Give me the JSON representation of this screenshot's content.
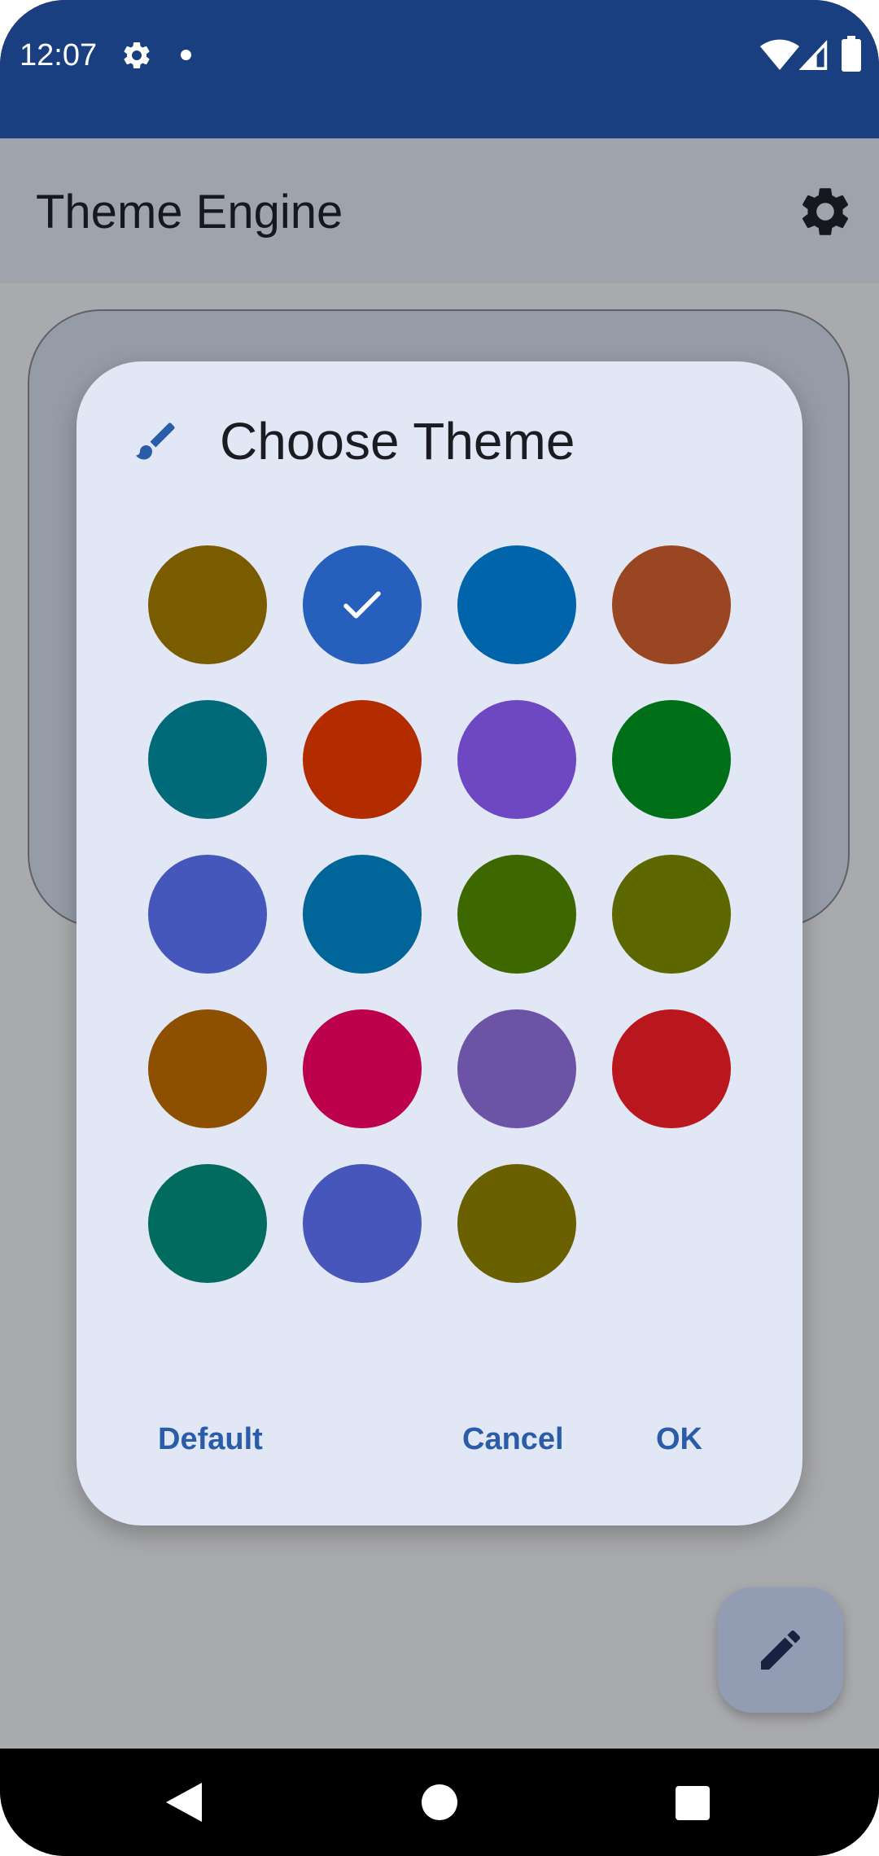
{
  "status_bar": {
    "time": "12:07",
    "icons": [
      "settings-icon",
      "notification-dot-icon",
      "wifi-icon",
      "signal-icon",
      "battery-icon"
    ]
  },
  "app_bar": {
    "title": "Theme Engine",
    "settings_icon": "gear-icon"
  },
  "dialog": {
    "icon": "paintbrush-icon",
    "title": "Choose Theme",
    "selected_index": 1,
    "swatches": [
      {
        "color": "#7a5c00"
      },
      {
        "color": "#265fbc"
      },
      {
        "color": "#0064aa"
      },
      {
        "color": "#9a4622"
      },
      {
        "color": "#006a78"
      },
      {
        "color": "#b22c00"
      },
      {
        "color": "#6e48c2"
      },
      {
        "color": "#007018"
      },
      {
        "color": "#4657bc"
      },
      {
        "color": "#006598"
      },
      {
        "color": "#3d6800"
      },
      {
        "color": "#5d6700"
      },
      {
        "color": "#8c5000"
      },
      {
        "color": "#bc004b"
      },
      {
        "color": "#6c53a6"
      },
      {
        "color": "#b9171d"
      },
      {
        "color": "#006b5e"
      },
      {
        "color": "#4656bb"
      },
      {
        "color": "#6a6000"
      }
    ],
    "buttons": {
      "default_label": "Default",
      "cancel_label": "Cancel",
      "ok_label": "OK"
    }
  },
  "fab": {
    "icon": "pencil-icon"
  },
  "nav_bar": {
    "back": "back-icon",
    "home": "home-icon",
    "recents": "recents-icon"
  },
  "colors": {
    "status_bar": "#1a3f80",
    "accent": "#2a5ca8",
    "dialog_bg": "#e1e7f4"
  }
}
